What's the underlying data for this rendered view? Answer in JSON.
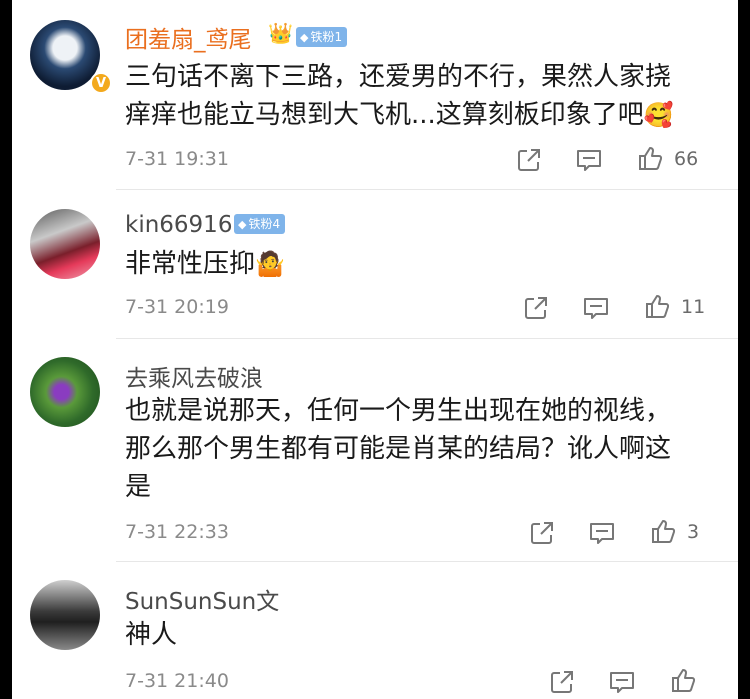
{
  "comments": [
    {
      "username": "团羞扇_鸢尾",
      "fan_badge": "铁粉1",
      "verified_badge": "V",
      "text_lines": [
        "三句话不离下三路，还爱男的不行，果然人家挠",
        "痒痒也能立马想到大飞机...这算刻板印象了吧"
      ],
      "emoji": "🥰",
      "time": "7-31 19:31",
      "likes": "66"
    },
    {
      "username": "kin66916",
      "fan_badge": "铁粉4",
      "text_lines": [
        "非常性压抑"
      ],
      "emoji": "🤷",
      "time": "7-31 20:19",
      "likes": "11"
    },
    {
      "username": "去乘风去破浪",
      "text_lines": [
        "也就是说那天，任何一个男生出现在她的视线，",
        "那么那个男生都有可能是肖某的结局？讹人啊这",
        "是"
      ],
      "time": "7-31 22:33",
      "likes": "3"
    },
    {
      "username": "SunSunSun文",
      "text_lines": [
        "神人"
      ],
      "time": "7-31 21:40",
      "likes": ""
    }
  ],
  "icons": {
    "share": "share-icon",
    "reply": "comment-icon",
    "like": "thumbs-up-icon"
  },
  "colors": {
    "username_highlight": "#ea6f1f",
    "fan_badge": "#7fb4ea"
  }
}
